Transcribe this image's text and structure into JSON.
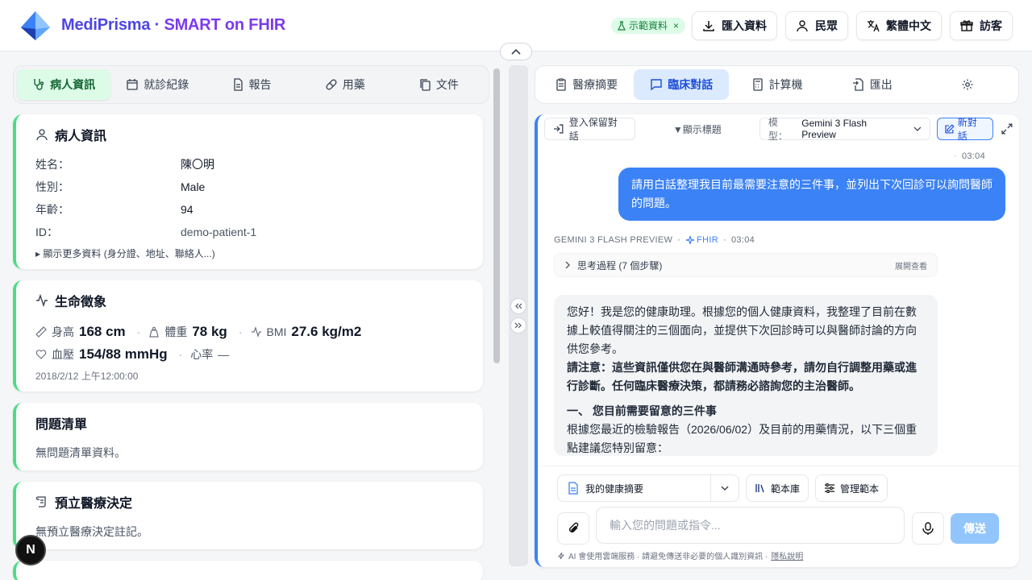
{
  "app": {
    "brand_main": "MediPrisma ·",
    "brand_sub": "SMART on FHIR"
  },
  "header": {
    "demo_badge": "示範資料",
    "import_label": "匯入資料",
    "role_label": "民眾",
    "language_label": "繁體中文",
    "user_label": "訪客"
  },
  "left_tabs": [
    "病人資訊",
    "就診紀錄",
    "報告",
    "用藥",
    "文件"
  ],
  "patient": {
    "title": "病人資訊",
    "fields": [
      {
        "k": "姓名：",
        "v": "陳〇明"
      },
      {
        "k": "性別：",
        "v": "Male"
      },
      {
        "k": "年齡：",
        "v": "94"
      },
      {
        "k": "ID：",
        "v": "demo-patient-1"
      }
    ],
    "more": "▸ 顯示更多資料 (身分證、地址、聯絡人...)"
  },
  "vitals": {
    "title": "生命徵象",
    "height_label": "身高",
    "height_value": "168 cm",
    "weight_label": "體重",
    "weight_value": "78 kg",
    "bmi_label": "BMI",
    "bmi_value": "27.6 kg/m2",
    "bp_label": "血壓",
    "bp_value": "154/88 mmHg",
    "hr_label": "心率",
    "hr_value": "—",
    "timestamp": "2018/2/12 上午12:00:00"
  },
  "problems": {
    "title": "問題清單",
    "empty": "無問題清單資料。"
  },
  "advance": {
    "title": "預立醫療決定",
    "empty": "無預立醫療決定註記。"
  },
  "right_tabs": [
    "醫療摘要",
    "臨床對話",
    "計算機",
    "匯出"
  ],
  "chat": {
    "login_save": "登入保留對話",
    "show_title": "▼顯示標題",
    "model_label": "模型：",
    "model_value": "Gemini 3 Flash Preview",
    "new_chat": "新對話",
    "prev_time": "03:04",
    "user_message": "請用白話整理我目前最需要注意的三件事，並列出下次回診可以詢問醫師的問題。",
    "ai_model": "GEMINI 3 FLASH PREVIEW",
    "fhir_tag": "FHIR",
    "ai_time": "03:04",
    "thinking": "思考過程 (7 個步驟)",
    "expand": "展開查看",
    "ai_p1": "您好！我是您的健康助理。根據您的個人健康資料，我整理了目前在數據上較值得關注的三個面向，並提供下次回診時可以與醫師討論的方向供您參考。",
    "ai_p2": "請注意：這些資訊僅供您在與醫師溝通時參考，請勿自行調整用藥或進行診斷。任何臨床醫療決策，都請務必諮詢您的主治醫師。",
    "ai_h1": "一、 您目前需要留意的三件事",
    "ai_p3": "根據您最近的檢驗報告（2026/06/02）及目前的用藥情況，以下三個重點建議您特別留意："
  },
  "composer": {
    "summary_label": "我的健康摘要",
    "library_label": "範本庫",
    "manage_label": "管理範本",
    "placeholder": "輸入您的問題或指令...",
    "send_label": "傳送",
    "note": "AI 會使用雲端服務 · 請避免傳送非必要的個人識別資訊 ·",
    "privacy_link": "隱私說明"
  },
  "dev_badge": "N"
}
